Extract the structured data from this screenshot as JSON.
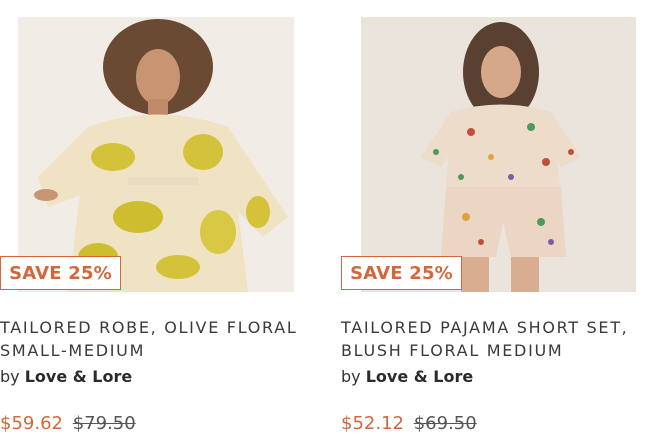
{
  "products": [
    {
      "badge": "SAVE 25%",
      "title_line1": "TAILORED ROBE, OLIVE FLORAL",
      "title_line2": "SMALL-MEDIUM",
      "brand_prefix": "by",
      "brand": "Love & Lore",
      "price": "$59.62",
      "compare_price": "$79.50"
    },
    {
      "badge": "SAVE 25%",
      "title_line1": "TAILORED PAJAMA SHORT SET,",
      "title_line2": "BLUSH FLORAL MEDIUM",
      "brand_prefix": "by",
      "brand": "Love & Lore",
      "price": "$52.12",
      "compare_price": "$69.50"
    }
  ],
  "colors": {
    "accent": "#d4663b",
    "text": "#333333"
  }
}
